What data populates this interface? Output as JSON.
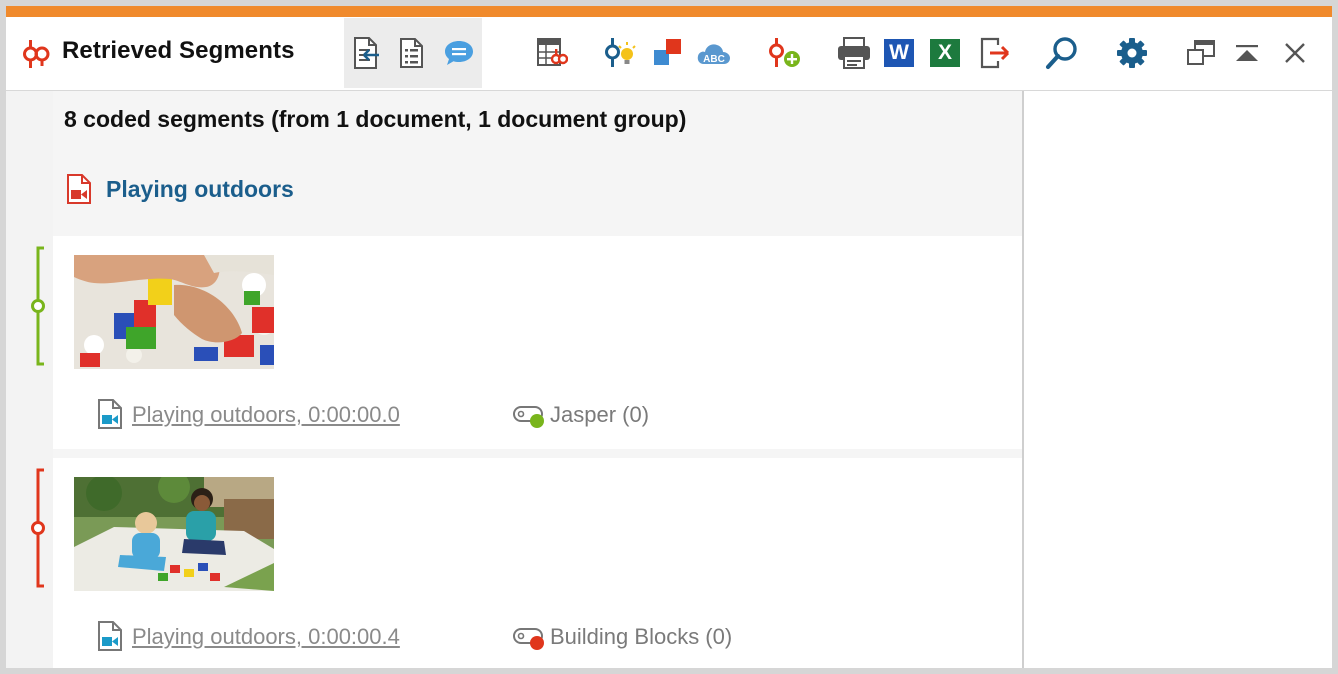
{
  "window": {
    "title": "Retrieved Segments",
    "accent_color": "#f08a2c"
  },
  "toolbar": {
    "view_buttons": [
      {
        "icon": "document-retrieve-icon"
      },
      {
        "icon": "list-view-icon"
      },
      {
        "icon": "comment-view-icon"
      }
    ],
    "action_buttons": [
      {
        "icon": "table-code-icon"
      },
      {
        "icon": "code-bulb-icon"
      },
      {
        "icon": "activate-shapes-icon"
      },
      {
        "icon": "abc-cloud-icon"
      },
      {
        "icon": "code-add-icon"
      },
      {
        "icon": "printer-icon"
      },
      {
        "icon": "word-export-icon",
        "letter": "W",
        "color": "#1e56b3"
      },
      {
        "icon": "excel-export-icon",
        "letter": "X",
        "color": "#1d7a3e"
      },
      {
        "icon": "export-icon"
      },
      {
        "icon": "search-icon"
      },
      {
        "icon": "gear-icon"
      }
    ],
    "window_controls": [
      {
        "icon": "undock-window-icon"
      },
      {
        "icon": "collapse-up-icon"
      },
      {
        "icon": "close-icon"
      }
    ]
  },
  "summary": "8 coded segments (from 1 document, 1 document group)",
  "document": {
    "title": "Playing outdoors",
    "icon": "video-document-icon",
    "icon_color": "#d8392b",
    "title_color": "#1b5e8c"
  },
  "segments": [
    {
      "thumbnail": "lego-blocks-thumbnail",
      "source": "Playing outdoors, 0:00:00.0",
      "code": "Jasper (0)",
      "code_color": "#79b51c",
      "bracket_color": "#79b51c"
    },
    {
      "thumbnail": "children-outdoors-thumbnail",
      "source": "Playing outdoors, 0:00:00.4",
      "code": "Building Blocks (0)",
      "code_color": "#e0361c",
      "bracket_color": "#e0361c"
    }
  ]
}
